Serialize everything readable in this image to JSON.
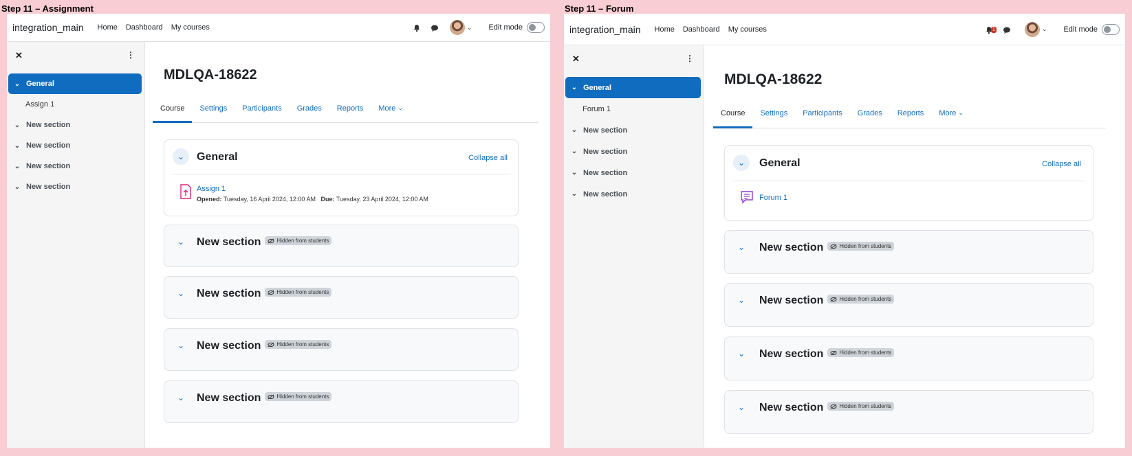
{
  "panels": [
    {
      "step_label": "Step 11 – Assignment",
      "navbar": {
        "brand": "integration_main",
        "links": [
          "Home",
          "Dashboard",
          "My courses"
        ],
        "edit_mode": "Edit mode",
        "notification_count": ""
      },
      "drawer": {
        "items": [
          {
            "label": "General",
            "type": "active"
          },
          {
            "label": "Assign 1",
            "type": "sub"
          },
          {
            "label": "New section",
            "type": "section"
          },
          {
            "label": "New section",
            "type": "section"
          },
          {
            "label": "New section",
            "type": "section"
          },
          {
            "label": "New section",
            "type": "section"
          }
        ]
      },
      "course_title": "MDLQA-18622",
      "tabs": [
        "Course",
        "Settings",
        "Participants",
        "Grades",
        "Reports",
        "More"
      ],
      "general": {
        "title": "General",
        "collapse_all": "Collapse all",
        "activity": {
          "icon": "assignment-icon",
          "name": "Assign 1",
          "opened_label": "Opened:",
          "opened_value": "Tuesday, 16 April 2024, 12:00 AM",
          "due_label": "Due:",
          "due_value": "Tuesday, 23 April 2024, 12:00 AM"
        }
      },
      "sections": [
        {
          "title": "New section",
          "badge": "Hidden from students"
        },
        {
          "title": "New section",
          "badge": "Hidden from students"
        },
        {
          "title": "New section",
          "badge": "Hidden from students"
        },
        {
          "title": "New section",
          "badge": "Hidden from students"
        }
      ]
    },
    {
      "step_label": "Step 11 – Forum",
      "navbar": {
        "brand": "integration_main",
        "links": [
          "Home",
          "Dashboard",
          "My courses"
        ],
        "edit_mode": "Edit mode",
        "notification_count": "1"
      },
      "drawer": {
        "items": [
          {
            "label": "General",
            "type": "active"
          },
          {
            "label": "Forum 1",
            "type": "sub"
          },
          {
            "label": "New section",
            "type": "section"
          },
          {
            "label": "New section",
            "type": "section"
          },
          {
            "label": "New section",
            "type": "section"
          },
          {
            "label": "New section",
            "type": "section"
          }
        ]
      },
      "course_title": "MDLQA-18622",
      "tabs": [
        "Course",
        "Settings",
        "Participants",
        "Grades",
        "Reports",
        "More"
      ],
      "general": {
        "title": "General",
        "collapse_all": "Collapse all",
        "activity": {
          "icon": "forum-icon",
          "name": "Forum 1"
        }
      },
      "sections": [
        {
          "title": "New section",
          "badge": "Hidden from students"
        },
        {
          "title": "New section",
          "badge": "Hidden from students"
        },
        {
          "title": "New section",
          "badge": "Hidden from students"
        },
        {
          "title": "New section",
          "badge": "Hidden from students"
        }
      ]
    }
  ],
  "colors": {
    "background": "#f8cdd3",
    "accent": "#0f6cbf",
    "drawer_bg": "#f5f5f5",
    "section_bg": "#f8f9fa",
    "badge_bg": "#ced4da",
    "notification": "#ca3120",
    "assignment_icon": "#e0237f",
    "forum_icon": "#8f3bd6"
  }
}
